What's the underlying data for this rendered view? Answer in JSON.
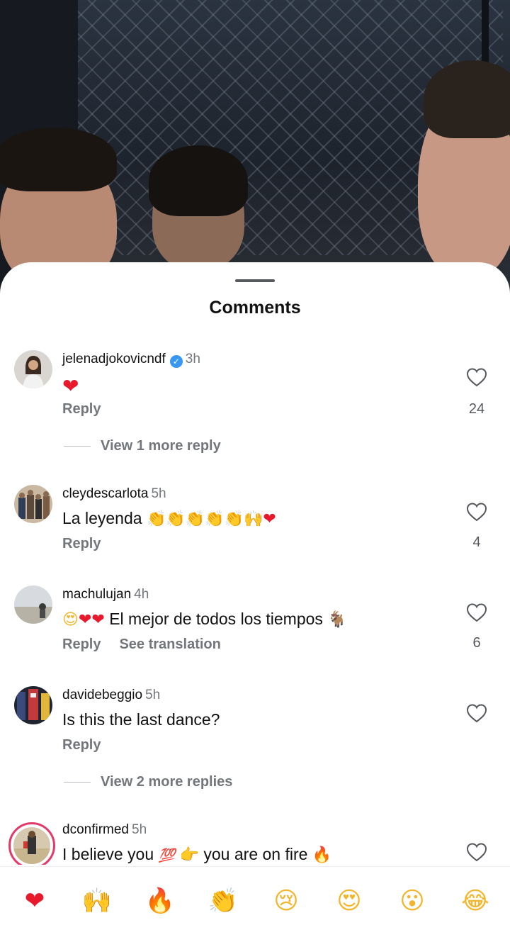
{
  "sheet": {
    "title": "Comments"
  },
  "comments": [
    {
      "username": "jelenadjokovicndf",
      "verified": true,
      "time": "3h",
      "text": "",
      "emojis": [
        "❤"
      ],
      "reply_label": "Reply",
      "extra_action": "",
      "likes": "24",
      "view_more": "View 1 more reply"
    },
    {
      "username": "cleydescarlota",
      "verified": false,
      "time": "5h",
      "text": "La leyenda",
      "emojis": [
        "👏",
        "👏",
        "👏",
        "👏",
        "👏",
        "🙌",
        "❤"
      ],
      "reply_label": "Reply",
      "extra_action": "",
      "likes": "4",
      "view_more": ""
    },
    {
      "username": "machulujan",
      "verified": false,
      "time": "4h",
      "text": "El mejor de todos los tiempos",
      "emojis_before": [
        "😍",
        "❤",
        "❤"
      ],
      "emojis_after": [
        "🐐"
      ],
      "reply_label": "Reply",
      "extra_action": "See translation",
      "likes": "6",
      "view_more": ""
    },
    {
      "username": "davidebeggio",
      "verified": false,
      "time": "5h",
      "text": "Is this the last dance?",
      "reply_label": "Reply",
      "extra_action": "",
      "likes": "",
      "view_more": "View 2 more replies"
    },
    {
      "username": "dconfirmed",
      "verified": false,
      "time": "5h",
      "text_part1": "I believe you",
      "emoji_mid": [
        "💯",
        "👉"
      ],
      "text_part2": "you are on fire",
      "emoji_end": [
        "🔥"
      ],
      "likes": ""
    }
  ],
  "reaction_bar": [
    "❤",
    "🙌",
    "🔥",
    "👏",
    "😢",
    "😍",
    "😮",
    "😂"
  ],
  "icons": {
    "like": "heart-outline-icon",
    "verified": "verified-badge-icon"
  },
  "colors": {
    "accent_red": "#e8192c",
    "muted_text": "#73767b",
    "verified_blue": "#3897f0"
  }
}
